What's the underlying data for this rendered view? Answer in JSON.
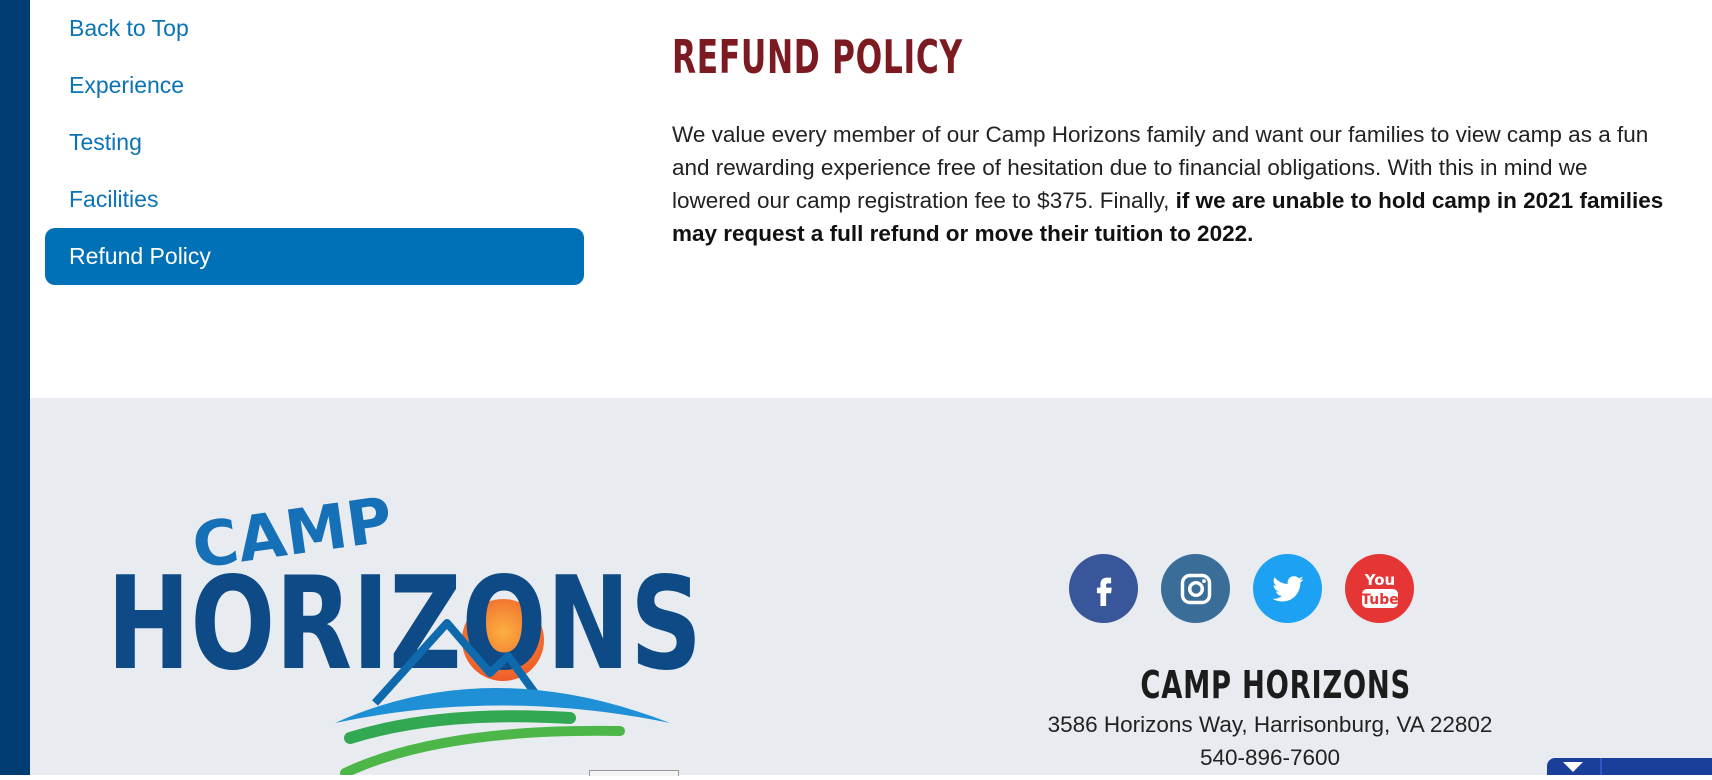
{
  "nav": {
    "items": [
      {
        "label": "Back to Top",
        "active": false
      },
      {
        "label": "Experience",
        "active": false
      },
      {
        "label": "Testing",
        "active": false
      },
      {
        "label": "Facilities",
        "active": false
      },
      {
        "label": "Refund Policy",
        "active": true
      }
    ]
  },
  "main": {
    "title": "REFUND POLICY",
    "paragraph_normal": "We value every member of our Camp Horizons family and want our families to view camp as a fun and rewarding experience free of hesitation due to financial obligations. With this in mind we lowered our camp registration fee to $375. Finally, ",
    "paragraph_bold": "if we are unable to hold camp in 2021 families may request a full refund or move their tuition to 2022."
  },
  "footer": {
    "logo": {
      "word_top": "CAMP",
      "word_main": "HORIZONS"
    },
    "social": [
      {
        "name": "facebook-icon",
        "color": "#3a569b"
      },
      {
        "name": "instagram-icon",
        "color": "#3a6e98"
      },
      {
        "name": "twitter-icon",
        "color": "#1da1f2"
      },
      {
        "name": "youtube-icon",
        "color": "#e53535",
        "glyph_top": "You",
        "glyph_bottom": "Tube"
      }
    ],
    "org_name": "CAMP HORIZONS",
    "address": "3586 Horizons Way, Harrisonburg, VA 22802",
    "phone": "540-896-7600"
  },
  "colors": {
    "accent_blue": "#0071b6",
    "title_red": "#7c1a22",
    "left_bar": "#003d73",
    "footer_bg": "#e8ecf0"
  }
}
